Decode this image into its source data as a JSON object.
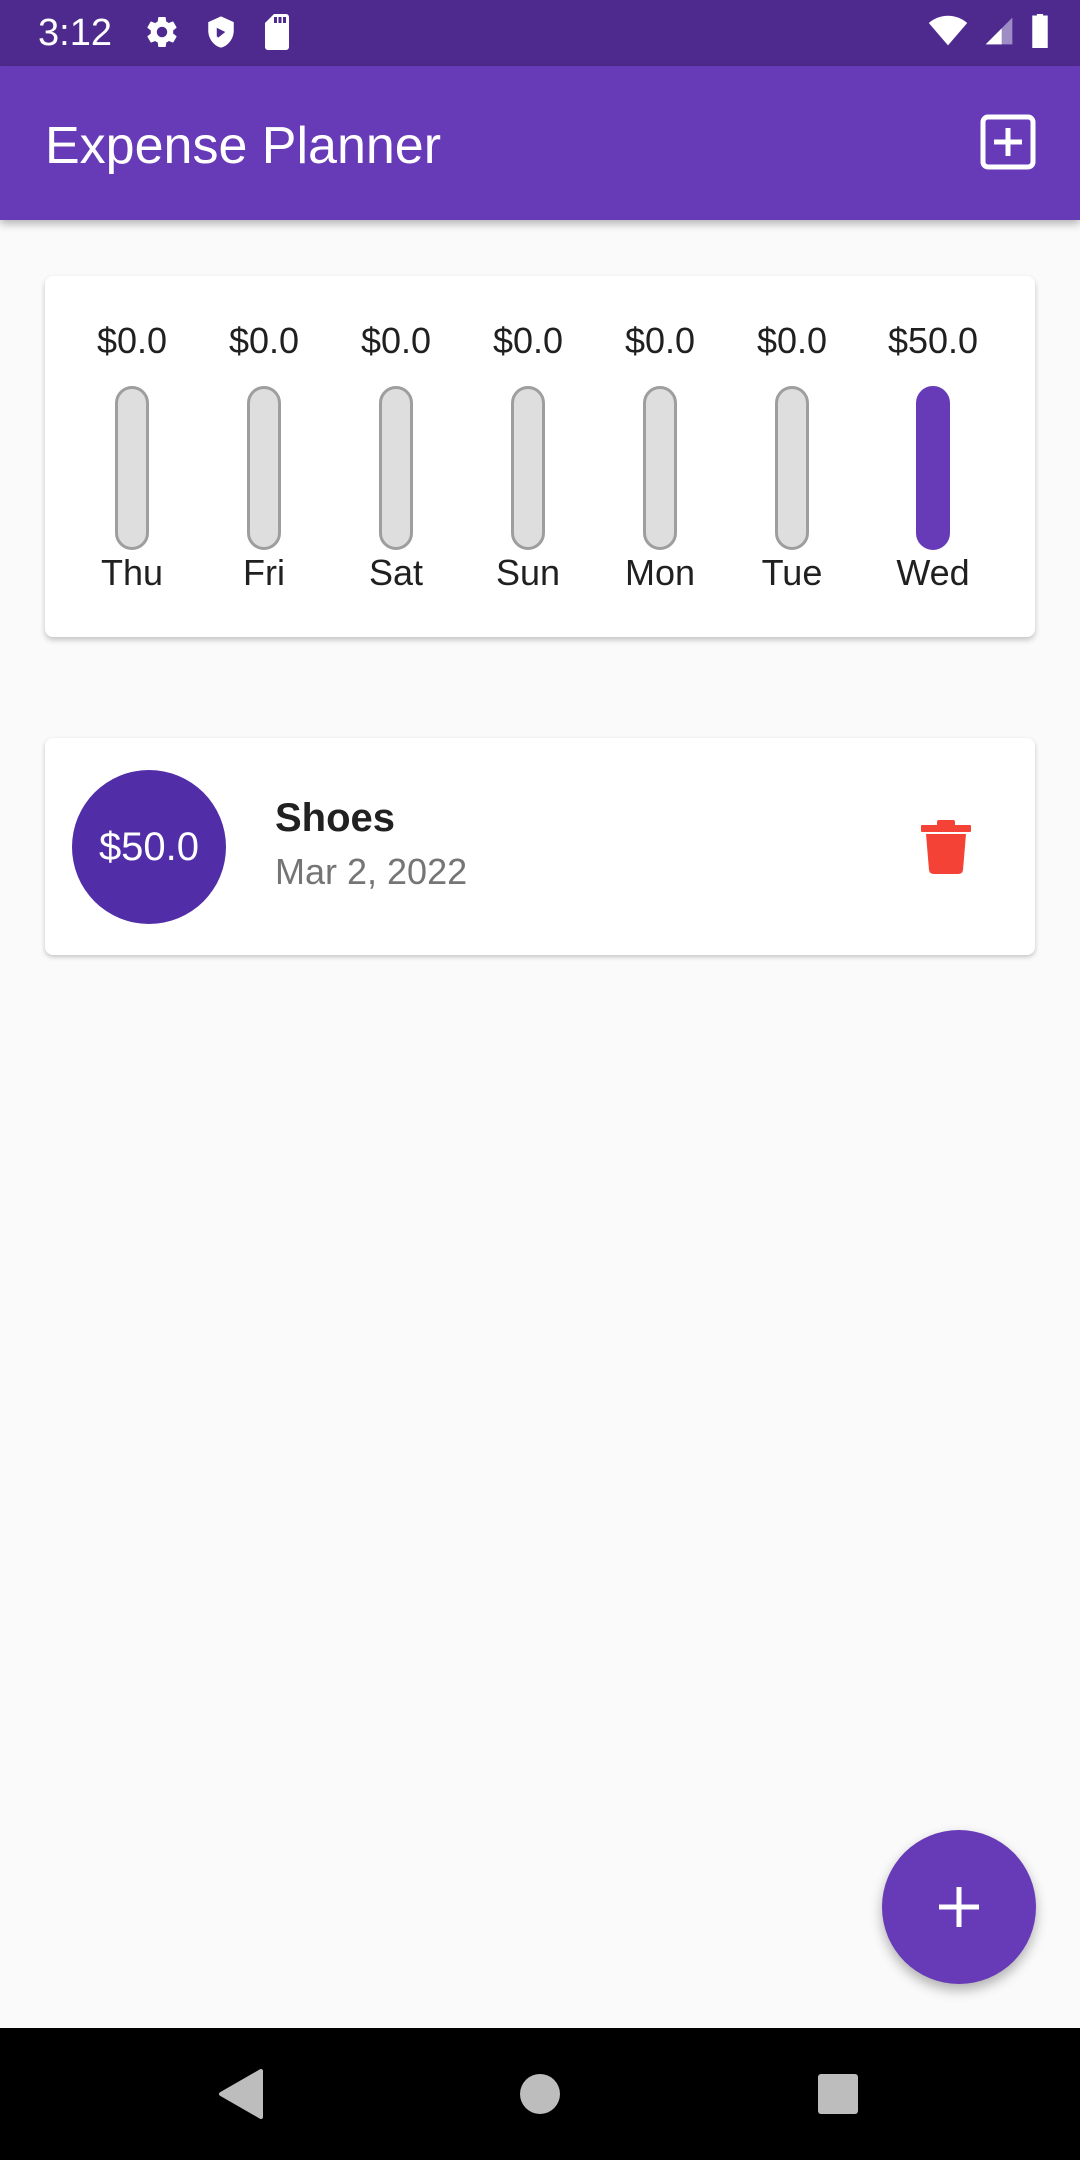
{
  "status_bar": {
    "time": "3:12",
    "left_icons": [
      "gear-icon",
      "shield-icon",
      "sd-card-icon"
    ],
    "right_icons": [
      "wifi-icon",
      "signal-icon",
      "battery-icon"
    ]
  },
  "app_bar": {
    "title": "Expense Planner",
    "action_icon": "add-box-icon",
    "color": "#673ab7"
  },
  "chart": {
    "accent_color": "#673ab7",
    "days": [
      {
        "day": "Thu",
        "amount": "$0.0",
        "fill": 0
      },
      {
        "day": "Fri",
        "amount": "$0.0",
        "fill": 0
      },
      {
        "day": "Sat",
        "amount": "$0.0",
        "fill": 0
      },
      {
        "day": "Sun",
        "amount": "$0.0",
        "fill": 0
      },
      {
        "day": "Mon",
        "amount": "$0.0",
        "fill": 0
      },
      {
        "day": "Tue",
        "amount": "$0.0",
        "fill": 0
      },
      {
        "day": "Wed",
        "amount": "$50.0",
        "fill": 1
      }
    ]
  },
  "transactions": [
    {
      "amount": "$50.0",
      "title": "Shoes",
      "date": "Mar 2, 2022",
      "delete_icon": "trash-icon",
      "delete_color": "#f44336"
    }
  ],
  "fab": {
    "icon": "plus-icon"
  },
  "nav_bar": {
    "icons": [
      "back-icon",
      "home-icon",
      "recents-icon"
    ]
  }
}
